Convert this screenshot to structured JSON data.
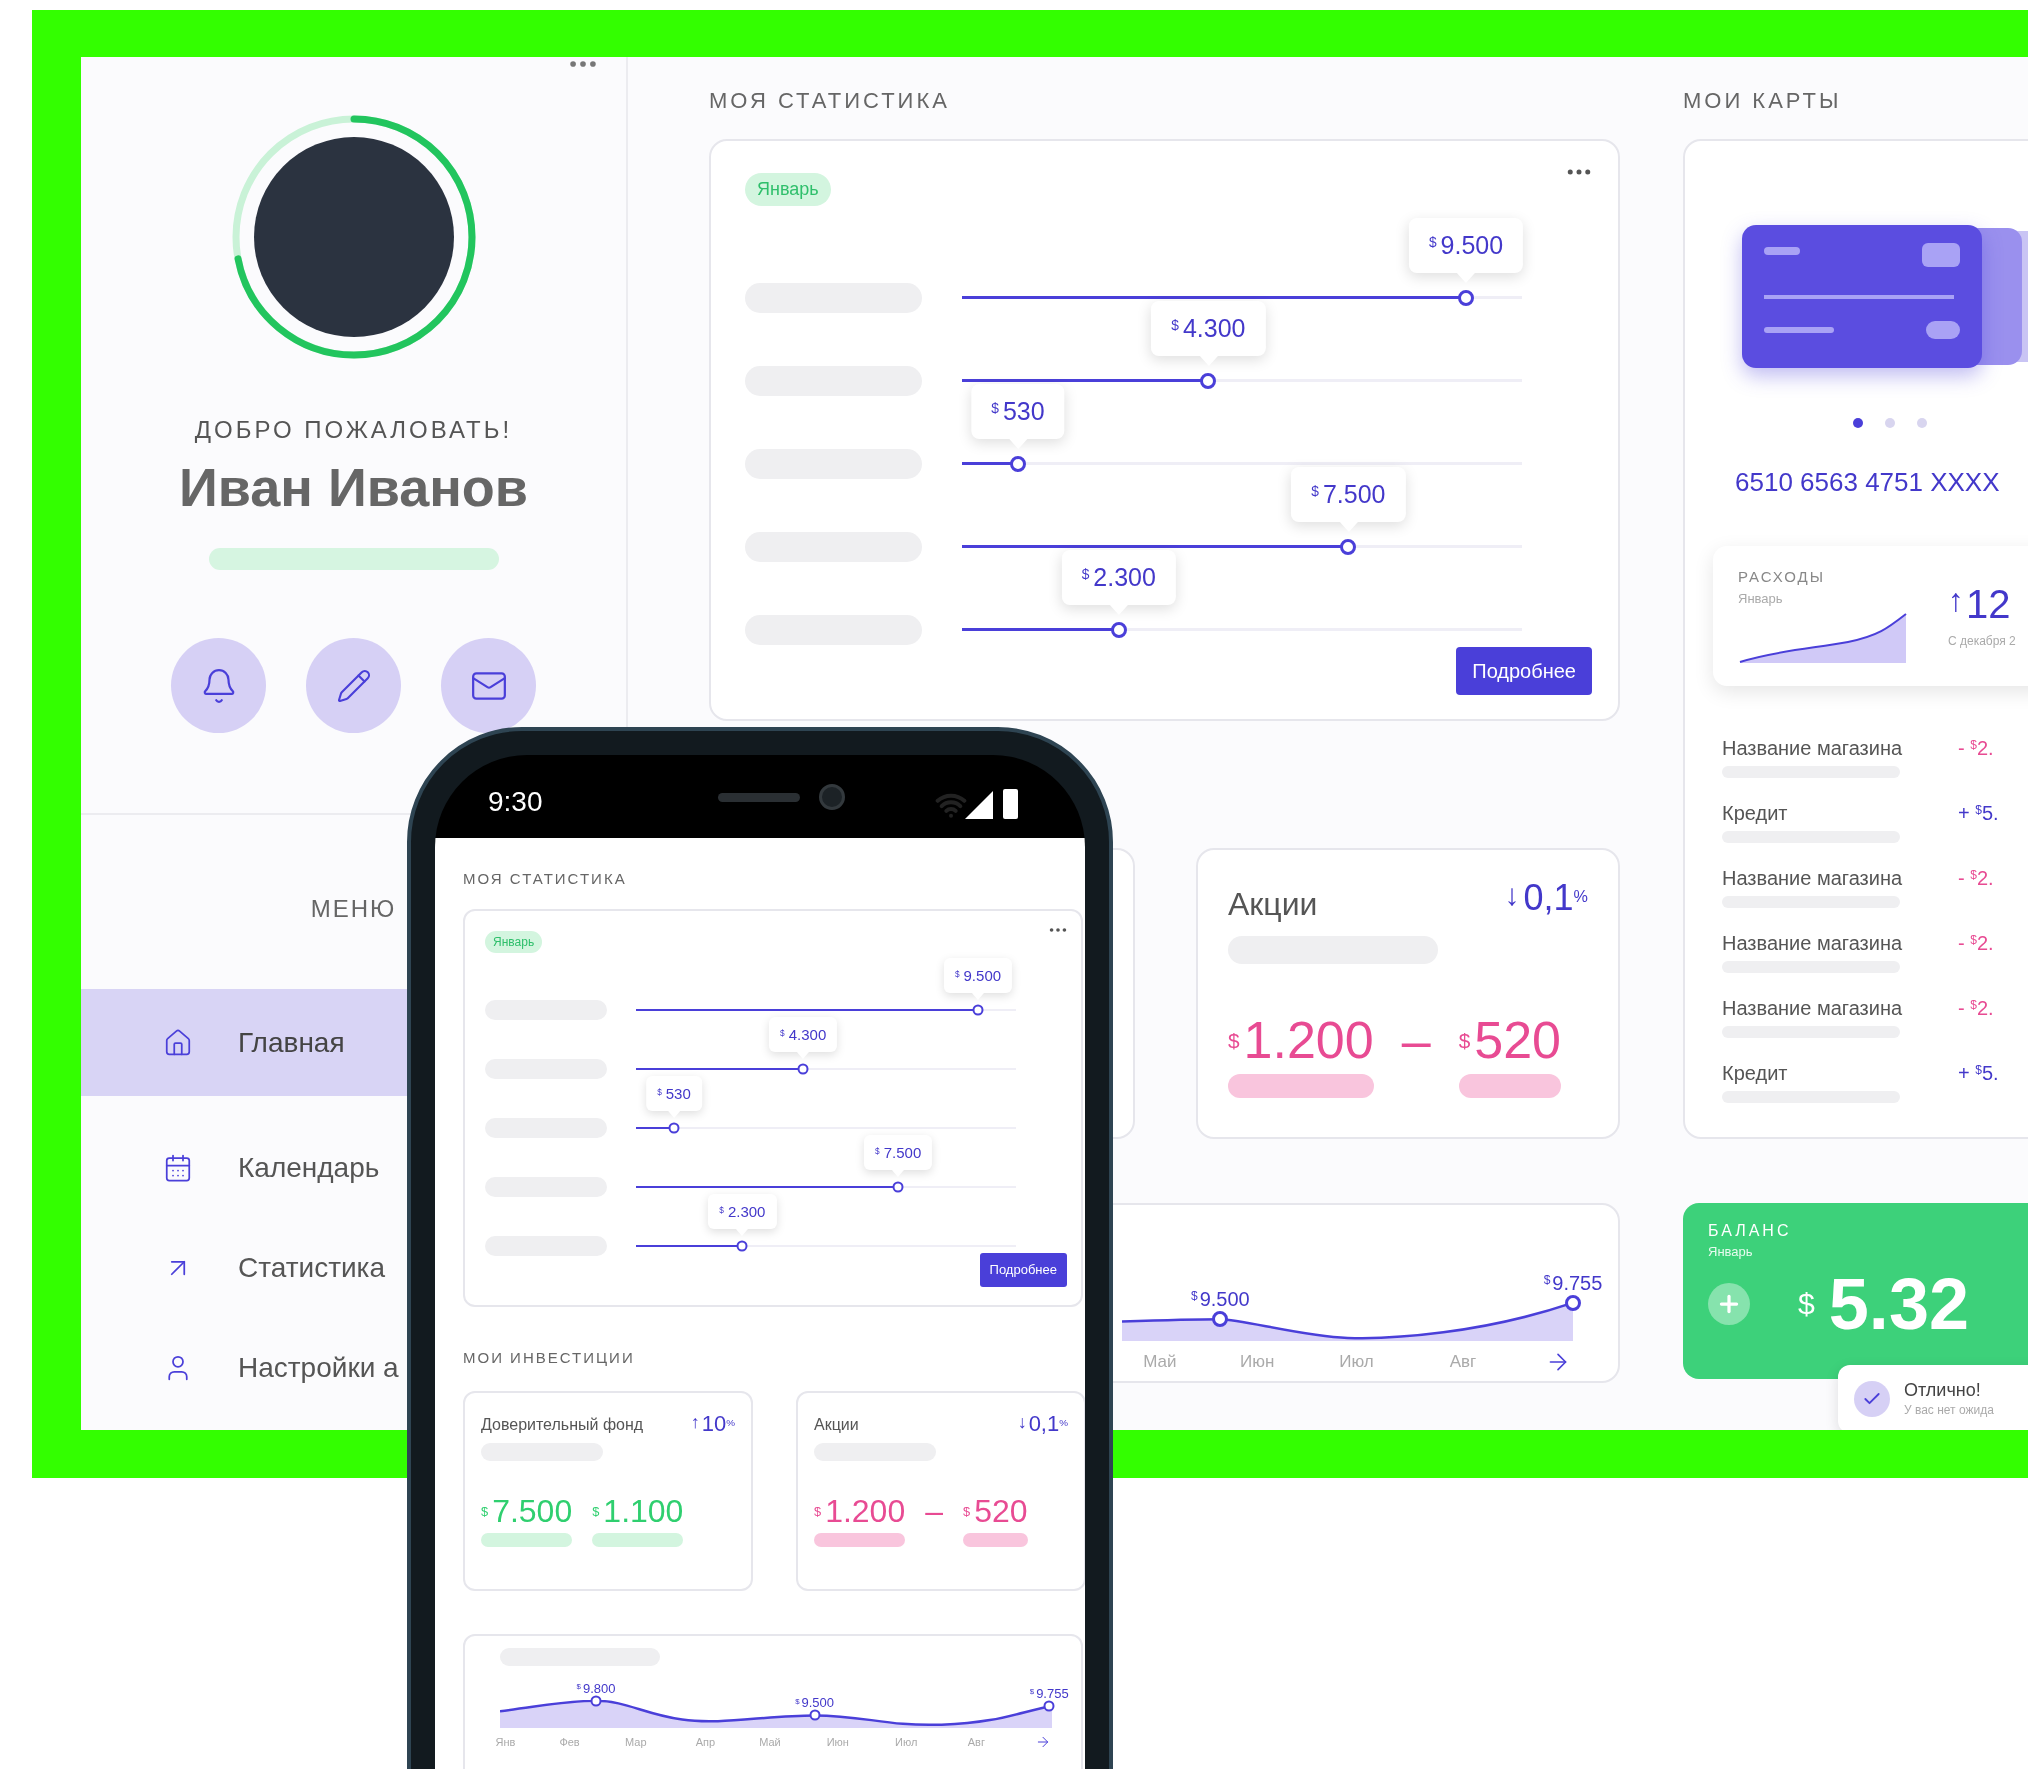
{
  "dashboard": {
    "sidebar": {
      "avatar_ring": {
        "level": 0.72
      },
      "greeting": "ДОБРО ПОЖАЛОВАТЬ!",
      "name": "Иван Иванов",
      "menu_title": "МЕНЮ",
      "menu": [
        {
          "label": "Главная",
          "selected": true
        },
        {
          "label": "Календарь",
          "selected": false
        },
        {
          "label": "Статистика",
          "selected": false
        },
        {
          "label": "Настройки а",
          "selected": false
        }
      ]
    },
    "statistics": {
      "title": "МОЯ СТАТИСТИКА",
      "badge": "Январь",
      "rows": [
        {
          "cur": "$",
          "value": "9.500",
          "level": 0.9
        },
        {
          "cur": "$",
          "value": "4.300",
          "level": 0.44
        },
        {
          "cur": "$",
          "value": "530",
          "level": 0.1
        },
        {
          "cur": "$",
          "value": "7.500",
          "level": 0.69
        },
        {
          "cur": "$",
          "value": "2.300",
          "level": 0.28
        }
      ],
      "button": "Подробнее"
    },
    "stocks": {
      "title": "Акции",
      "arrow": "↓",
      "change": "0,1",
      "unit": "%",
      "kind": "loss",
      "amounts": [
        {
          "cur": "$",
          "value": "1.200"
        },
        {
          "cur": "$",
          "value": "520"
        }
      ],
      "separator": "–"
    },
    "trend": {
      "points": [
        {
          "cur": "$",
          "value": "9.500"
        },
        {
          "cur": "$",
          "value": "9.755"
        }
      ],
      "months": [
        "Май",
        "Июн",
        "Июл",
        "Авг"
      ]
    },
    "cards": {
      "title": "МОИ КАРТЫ",
      "pager": [
        {
          "selected": true
        },
        {
          "selected": false
        },
        {
          "selected": false
        }
      ],
      "number": "6510 6563 4751 XXXX",
      "expenses": {
        "title": "РАСХОДЫ",
        "period": "Январь",
        "arrow": "↑",
        "change": "12",
        "note": "С декабря 2"
      },
      "transactions": [
        {
          "name": "Название магазина",
          "kind": "expense",
          "sign": "-",
          "cur": "$",
          "amount": "2."
        },
        {
          "name": "Кредит",
          "kind": "income",
          "sign": "+",
          "cur": "$",
          "amount": "5."
        },
        {
          "name": "Название магазина",
          "kind": "expense",
          "sign": "-",
          "cur": "$",
          "amount": "2."
        },
        {
          "name": "Название магазина",
          "kind": "expense",
          "sign": "-",
          "cur": "$",
          "amount": "2."
        },
        {
          "name": "Название магазина",
          "kind": "expense",
          "sign": "-",
          "cur": "$",
          "amount": "2."
        },
        {
          "name": "Кредит",
          "kind": "income",
          "sign": "+",
          "cur": "$",
          "amount": "5."
        }
      ]
    },
    "balance": {
      "title": "БАЛАНС",
      "period": "Январь",
      "cur": "$",
      "amount": "5.32"
    },
    "toast": {
      "title": "Отлично!",
      "text": "У вас нет ожида"
    }
  },
  "phone": {
    "time": "9:30",
    "statistics": {
      "title": "МОЯ СТАТИСТИКА",
      "badge": "Январь",
      "rows": [
        {
          "cur": "$",
          "value": "9.500",
          "level": 0.9
        },
        {
          "cur": "$",
          "value": "4.300",
          "level": 0.44
        },
        {
          "cur": "$",
          "value": "530",
          "level": 0.1
        },
        {
          "cur": "$",
          "value": "7.500",
          "level": 0.69
        },
        {
          "cur": "$",
          "value": "2.300",
          "level": 0.28
        }
      ],
      "button": "Подробнее"
    },
    "investments_title": "МОИ ИНВЕСТИЦИИ",
    "investments": [
      {
        "title": "Доверительный фонд",
        "arrow": "↑",
        "change": "10",
        "unit": "%",
        "kind": "gain",
        "amounts": [
          {
            "cur": "$",
            "value": "7.500"
          },
          {
            "cur": "$",
            "value": "1.100"
          }
        ]
      },
      {
        "title": "Акции",
        "arrow": "↓",
        "change": "0,1",
        "unit": "%",
        "kind": "loss",
        "amounts": [
          {
            "cur": "$",
            "value": "1.200"
          },
          {
            "cur": "$",
            "value": "520"
          }
        ],
        "separator": "–"
      }
    ],
    "trend": {
      "points": [
        {
          "cur": "$",
          "value": "9.800"
        },
        {
          "cur": "$",
          "value": "9.500"
        },
        {
          "cur": "$",
          "value": "9.755"
        }
      ],
      "months": [
        "Янв",
        "Фев",
        "Мар",
        "Апр",
        "Май",
        "Июн",
        "Июл",
        "Авг"
      ]
    }
  }
}
